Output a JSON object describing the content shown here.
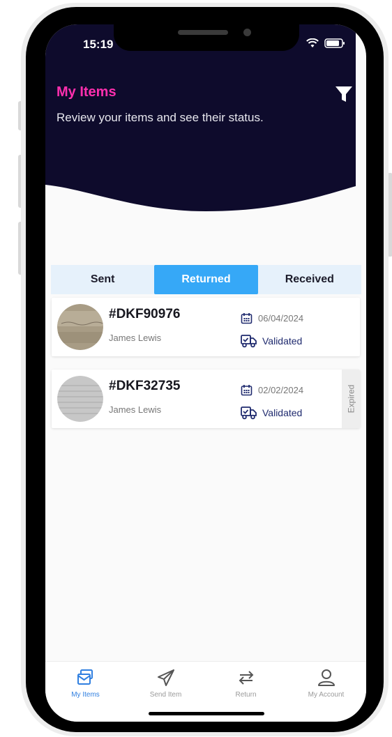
{
  "status_bar": {
    "time": "15:19"
  },
  "header": {
    "title": "My Items",
    "subtitle": "Review your items and see their status."
  },
  "tabs": [
    {
      "label": "Sent",
      "active": false
    },
    {
      "label": "Returned",
      "active": true
    },
    {
      "label": "Received",
      "active": false
    }
  ],
  "items": [
    {
      "id": "#DKF90976",
      "name": "James Lewis",
      "date": "06/04/2024",
      "status": "Validated",
      "badge": ""
    },
    {
      "id": "#DKF32735",
      "name": "James Lewis",
      "date": "02/02/2024",
      "status": "Validated",
      "badge": "Expired"
    }
  ],
  "bottom_nav": [
    {
      "label": "My Items",
      "icon": "my-items-icon",
      "active": true
    },
    {
      "label": "Send Item",
      "icon": "send-icon",
      "active": false
    },
    {
      "label": "Return",
      "icon": "return-icon",
      "active": false
    },
    {
      "label": "My Account",
      "icon": "account-icon",
      "active": false
    }
  ],
  "colors": {
    "header_bg": "#0e0b2c",
    "title": "#ff2fae",
    "accent": "#36a8f7",
    "status_text": "#1f2a6e"
  }
}
